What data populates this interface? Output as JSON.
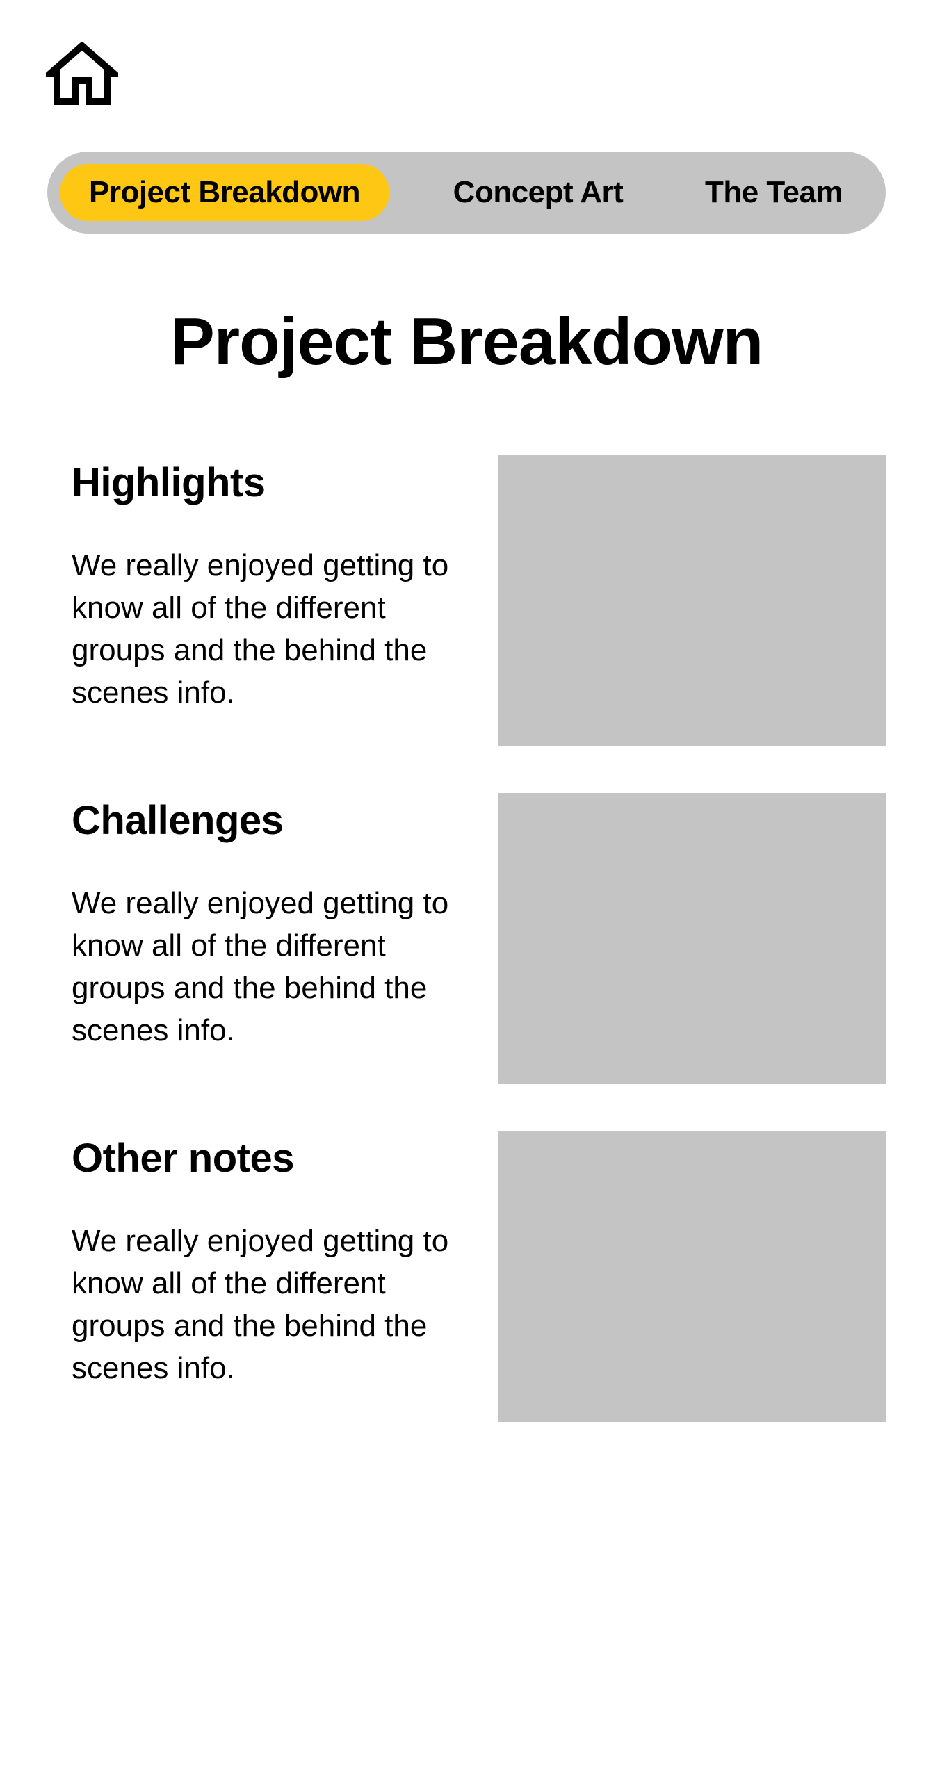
{
  "home": {
    "icon": "home-icon"
  },
  "nav": {
    "tabs": [
      {
        "label": "Project Breakdown",
        "active": true
      },
      {
        "label": "Concept Art",
        "active": false
      },
      {
        "label": "The Team",
        "active": false
      }
    ]
  },
  "page_title": "Project Breakdown",
  "sections": [
    {
      "heading": "Highlights",
      "body": "We really enjoyed getting to know all of the different groups and the behind the scenes info."
    },
    {
      "heading": "Challenges",
      "body": "We really enjoyed getting to know all of the different groups and the behind the scenes info."
    },
    {
      "heading": "Other notes",
      "body": "We really enjoyed getting to know all of the different groups and the behind the scenes info."
    }
  ],
  "colors": {
    "accent": "#fdc713",
    "tabbar_bg": "#c4c4c4",
    "placeholder_bg": "#c4c4c4",
    "text": "#000000",
    "background": "#ffffff"
  }
}
